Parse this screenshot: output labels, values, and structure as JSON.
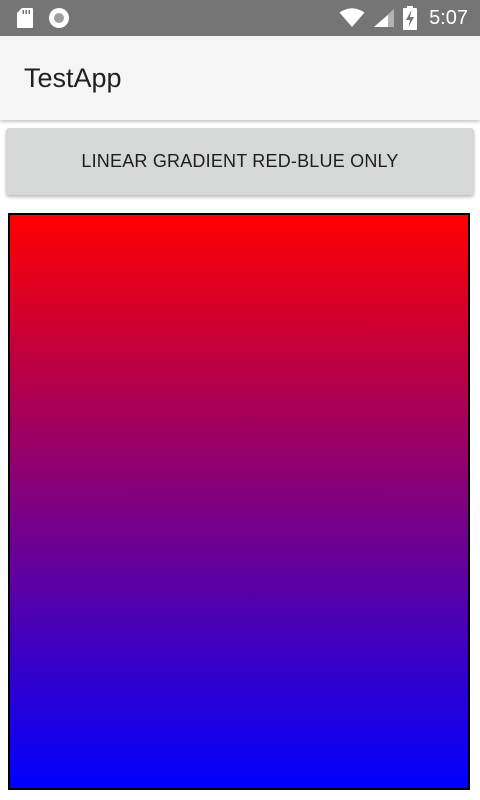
{
  "status_bar": {
    "time": "5:07",
    "icons": [
      "sd-card-icon",
      "record-icon",
      "wifi-icon",
      "signal-icon",
      "battery-charging-icon"
    ]
  },
  "app_bar": {
    "title": "TestApp"
  },
  "button": {
    "label": "LINEAR GRADIENT RED-BLUE ONLY"
  },
  "gradient": {
    "type": "linear",
    "start_color": "#ff0000",
    "end_color": "#0000ff",
    "border_color": "#000000"
  },
  "colors": {
    "status_bar_bg": "#757575",
    "app_bar_bg": "#f5f5f5",
    "button_bg": "#d6d7d7"
  }
}
